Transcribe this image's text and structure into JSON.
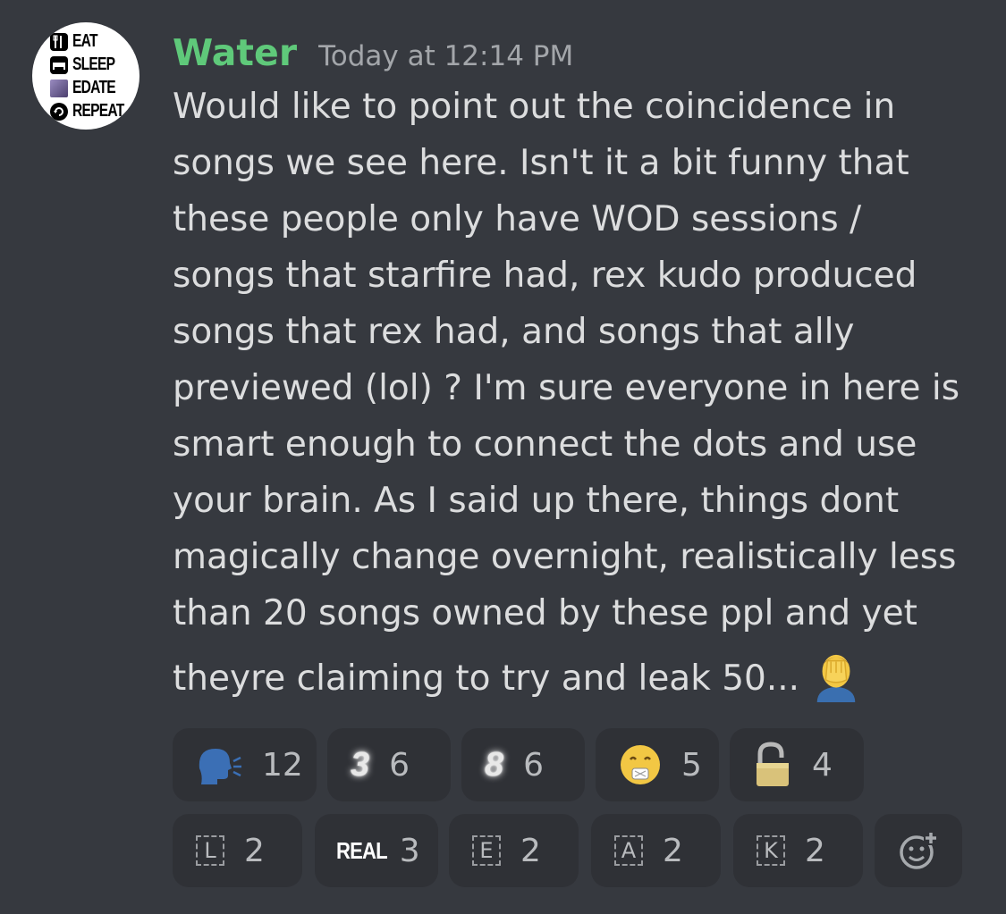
{
  "avatar": {
    "lines": [
      "EAT",
      "SLEEP",
      "EDATE",
      "REPEAT"
    ],
    "icons": [
      "fork-knife-icon",
      "bed-icon",
      "picture-icon",
      "repeat-icon"
    ]
  },
  "message": {
    "username": "Water",
    "timestamp": "Today at 12:14 PM",
    "username_color": "#5fc97a",
    "lines": [
      "Would like to point out the coincidence in",
      "songs we see here. Isn't it a bit funny that",
      "these people only have WOD sessions /",
      "songs that starfire had, rex kudo produced",
      "songs that rex had, and songs that ally",
      "previewed (lol) ? I'm sure everyone in here is",
      "smart enough to connect the dots and use",
      "your brain. As I said up there, things dont",
      "magically change overnight, realistically less",
      "than 20 songs owned by these ppl and yet",
      "theyre claiming to try and leak 50..."
    ],
    "trailing_emoji": "facepalm-emoji"
  },
  "reactions": {
    "row1": [
      {
        "emoji": "speaking-head-emoji",
        "count": "12"
      },
      {
        "emoji": "glowing-three-emoji",
        "glyph": "3",
        "count": "6"
      },
      {
        "emoji": "glowing-eight-emoji",
        "glyph": "8",
        "count": "6"
      },
      {
        "emoji": "money-mouth-emoji",
        "count": "5"
      },
      {
        "emoji": "lock-open-emoji",
        "count": "4"
      }
    ],
    "row2": [
      {
        "emoji": "regional-letter-l",
        "glyph": "L",
        "count": "2"
      },
      {
        "emoji": "real-text-emoji",
        "glyph": "REAL",
        "count": "3"
      },
      {
        "emoji": "regional-letter-e",
        "glyph": "E",
        "count": "2"
      },
      {
        "emoji": "regional-letter-a",
        "glyph": "A",
        "count": "2"
      },
      {
        "emoji": "regional-letter-k",
        "glyph": "K",
        "count": "2"
      }
    ],
    "add_reaction_icon": "add-reaction-icon"
  },
  "colors": {
    "background": "#36393f",
    "reaction_bg": "#2f3136",
    "text": "#dcddde",
    "muted": "#a3a6aa"
  }
}
